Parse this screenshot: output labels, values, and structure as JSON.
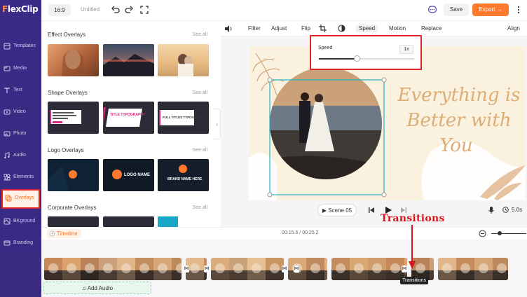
{
  "app": {
    "name": "FlexClip"
  },
  "sidebar": {
    "items": [
      {
        "label": "Templates",
        "icon": "templates-icon"
      },
      {
        "label": "Media",
        "icon": "media-icon"
      },
      {
        "label": "Text",
        "icon": "text-icon"
      },
      {
        "label": "Video",
        "icon": "video-icon"
      },
      {
        "label": "Photo",
        "icon": "photo-icon"
      },
      {
        "label": "Audio",
        "icon": "audio-icon"
      },
      {
        "label": "Elements",
        "icon": "elements-icon"
      },
      {
        "label": "Overlays",
        "icon": "overlays-icon",
        "active": true
      },
      {
        "label": "BKground",
        "icon": "background-icon"
      },
      {
        "label": "Branding",
        "icon": "branding-icon"
      }
    ]
  },
  "topbar": {
    "ratio": "16:9",
    "title": "Untitled",
    "save": "Save",
    "export": "Export →"
  },
  "panel": {
    "sections": [
      {
        "title": "Effect Overlays",
        "see_all": "See all"
      },
      {
        "title": "Shape Overlays",
        "see_all": "See all"
      },
      {
        "title": "Logo Overlays",
        "see_all": "See all"
      },
      {
        "title": "Corporate Overlays",
        "see_all": "See all"
      }
    ],
    "shape_thumbs": [
      "TITLE TYPOGRAPHY",
      "FULL TITLES TYPOGRAPHY"
    ],
    "logo_thumbs": [
      "LOGO NAME",
      "BRAND NAME HERE"
    ]
  },
  "toolbar": {
    "tools": [
      "Filter",
      "Adjust",
      "Flip",
      "Speed",
      "Motion",
      "Replace",
      "Align"
    ]
  },
  "speed_popup": {
    "label": "Speed",
    "value": "1x",
    "level": 0.4
  },
  "canvas": {
    "script_text": [
      "Everything is",
      "Better with",
      "You"
    ]
  },
  "playbar": {
    "scene": "Scene 05",
    "duration": "5.0s"
  },
  "timeline": {
    "label": "Timeline",
    "time": "00:15.6 / 00:25.2",
    "add_audio": "Add Audio",
    "annotation": "Transitions",
    "tooltip": "Transitions"
  },
  "colors": {
    "accent": "#ff7a2d",
    "sidebar": "#3b2a86",
    "highlight": "#e0262b"
  }
}
